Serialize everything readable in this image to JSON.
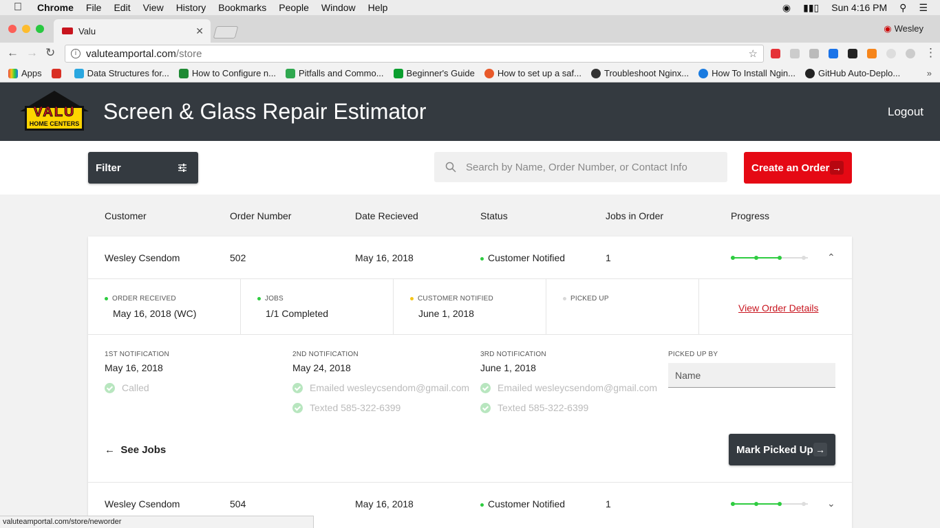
{
  "menubar": {
    "app": "Chrome",
    "items": [
      "File",
      "Edit",
      "View",
      "History",
      "Bookmarks",
      "People",
      "Window",
      "Help"
    ],
    "clock": "Sun 4:16 PM"
  },
  "browser": {
    "tab_title": "Valu",
    "profile": "Wesley",
    "url_host": "valuteamportal.com",
    "url_path": "/store",
    "status_url": "valuteamportal.com/store/neworder"
  },
  "bookmarks": [
    {
      "label": "Apps",
      "color": "#e8453c"
    },
    {
      "label": "",
      "color": "#d93025"
    },
    {
      "label": "Data Structures for...",
      "color": "#2aa7e0"
    },
    {
      "label": "How to Configure n...",
      "color": "#1f8a34"
    },
    {
      "label": "Pitfalls and Commo...",
      "color": "#2fa84f"
    },
    {
      "label": "Beginner's Guide",
      "color": "#0a9e2e"
    },
    {
      "label": "How to set up a saf...",
      "color": "#e8592a"
    },
    {
      "label": "Troubleshoot Nginx...",
      "color": "#333333"
    },
    {
      "label": "How To Install Ngin...",
      "color": "#1a7be0"
    },
    {
      "label": "GitHub Auto-Deplo...",
      "color": "#222222"
    }
  ],
  "app": {
    "logo_text": "VALU",
    "logo_sub": "HOME CENTERS",
    "title": "Screen & Glass Repair Estimator",
    "logout": "Logout"
  },
  "toolbar": {
    "filter_label": "Filter",
    "search_placeholder": "Search by Name, Order Number, or Contact Info",
    "create_label": "Create an Order"
  },
  "columns": [
    "Customer",
    "Order Number",
    "Date Recieved",
    "Status",
    "Jobs in Order",
    "Progress"
  ],
  "orders": [
    {
      "customer": "Wesley Csendom",
      "number": "502",
      "date": "May 16, 2018",
      "status": "Customer Notified",
      "jobs": "1",
      "progress_steps_done": 3,
      "progress_steps_total": 4,
      "expanded": true
    },
    {
      "customer": "Wesley Csendom",
      "number": "504",
      "date": "May 16, 2018",
      "status": "Customer Notified",
      "jobs": "1",
      "progress_steps_done": 3,
      "progress_steps_total": 4,
      "expanded": false
    }
  ],
  "detail": {
    "stages": [
      {
        "label": "ORDER RECEIVED",
        "value": "May 16, 2018 (WC)",
        "color": "#2ecc40"
      },
      {
        "label": "JOBS",
        "value": "1/1 Completed",
        "color": "#2ecc40"
      },
      {
        "label": "CUSTOMER NOTIFIED",
        "value": "June 1, 2018",
        "color": "#f5c518"
      },
      {
        "label": "PICKED UP",
        "value": "",
        "color": "#d8d8d8"
      }
    ],
    "view_details": "View Order Details",
    "notifications": [
      {
        "label": "1ST NOTIFICATION",
        "date": "May 16, 2018",
        "actions": [
          "Called"
        ]
      },
      {
        "label": "2ND NOTIFICATION",
        "date": "May 24, 2018",
        "actions": [
          "Emailed wesleycsendom@gmail.com",
          "Texted 585-322-6399"
        ]
      },
      {
        "label": "3RD NOTIFICATION",
        "date": "June 1, 2018",
        "actions": [
          "Emailed wesleycsendom@gmail.com",
          "Texted 585-322-6399"
        ]
      }
    ],
    "picked_up_by_label": "PICKED UP BY",
    "picked_up_by_placeholder": "Name",
    "see_jobs": "See Jobs",
    "mark_picked_up": "Mark Picked Up"
  },
  "colors": {
    "header_bg": "#343a40",
    "accent_red": "#e50914",
    "status_green": "#2ecc40",
    "status_yellow": "#f5c518"
  }
}
